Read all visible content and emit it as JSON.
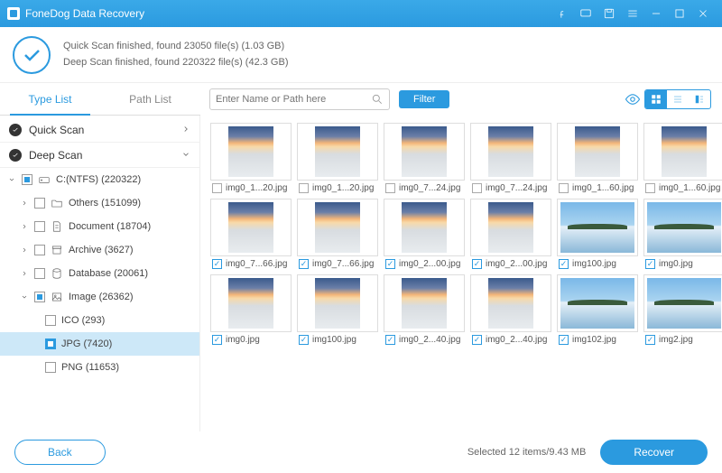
{
  "titlebar": {
    "title": "FoneDog Data Recovery"
  },
  "status": {
    "quick": "Quick Scan finished, found 23050 file(s) (1.03 GB)",
    "deep": "Deep Scan finished, found 220322 file(s) (42.3 GB)"
  },
  "tabs": {
    "type": "Type List",
    "path": "Path List"
  },
  "search": {
    "placeholder": "Enter Name or Path here"
  },
  "filter_label": "Filter",
  "sidebar": {
    "quick": "Quick Scan",
    "deep": "Deep Scan",
    "drive": "C:(NTFS) (220322)",
    "others": "Others (151099)",
    "document": "Document (18704)",
    "archive": "Archive (3627)",
    "database": "Database (20061)",
    "image": "Image (26362)",
    "ico": "ICO (293)",
    "jpg": "JPG (7420)",
    "png": "PNG (11653)"
  },
  "files": {
    "r1": [
      "img0_1...20.jpg",
      "img0_1...20.jpg",
      "img0_7...24.jpg",
      "img0_7...24.jpg",
      "img0_1...60.jpg",
      "img0_1...60.jpg"
    ],
    "r2": [
      "img0_7...66.jpg",
      "img0_7...66.jpg",
      "img0_2...00.jpg",
      "img0_2...00.jpg",
      "img100.jpg",
      "img0.jpg"
    ],
    "r3": [
      "img0.jpg",
      "img100.jpg",
      "img0_2...40.jpg",
      "img0_2...40.jpg",
      "img102.jpg",
      "img2.jpg"
    ]
  },
  "footer": {
    "back": "Back",
    "selected": "Selected 12 items/9.43 MB",
    "recover": "Recover"
  }
}
